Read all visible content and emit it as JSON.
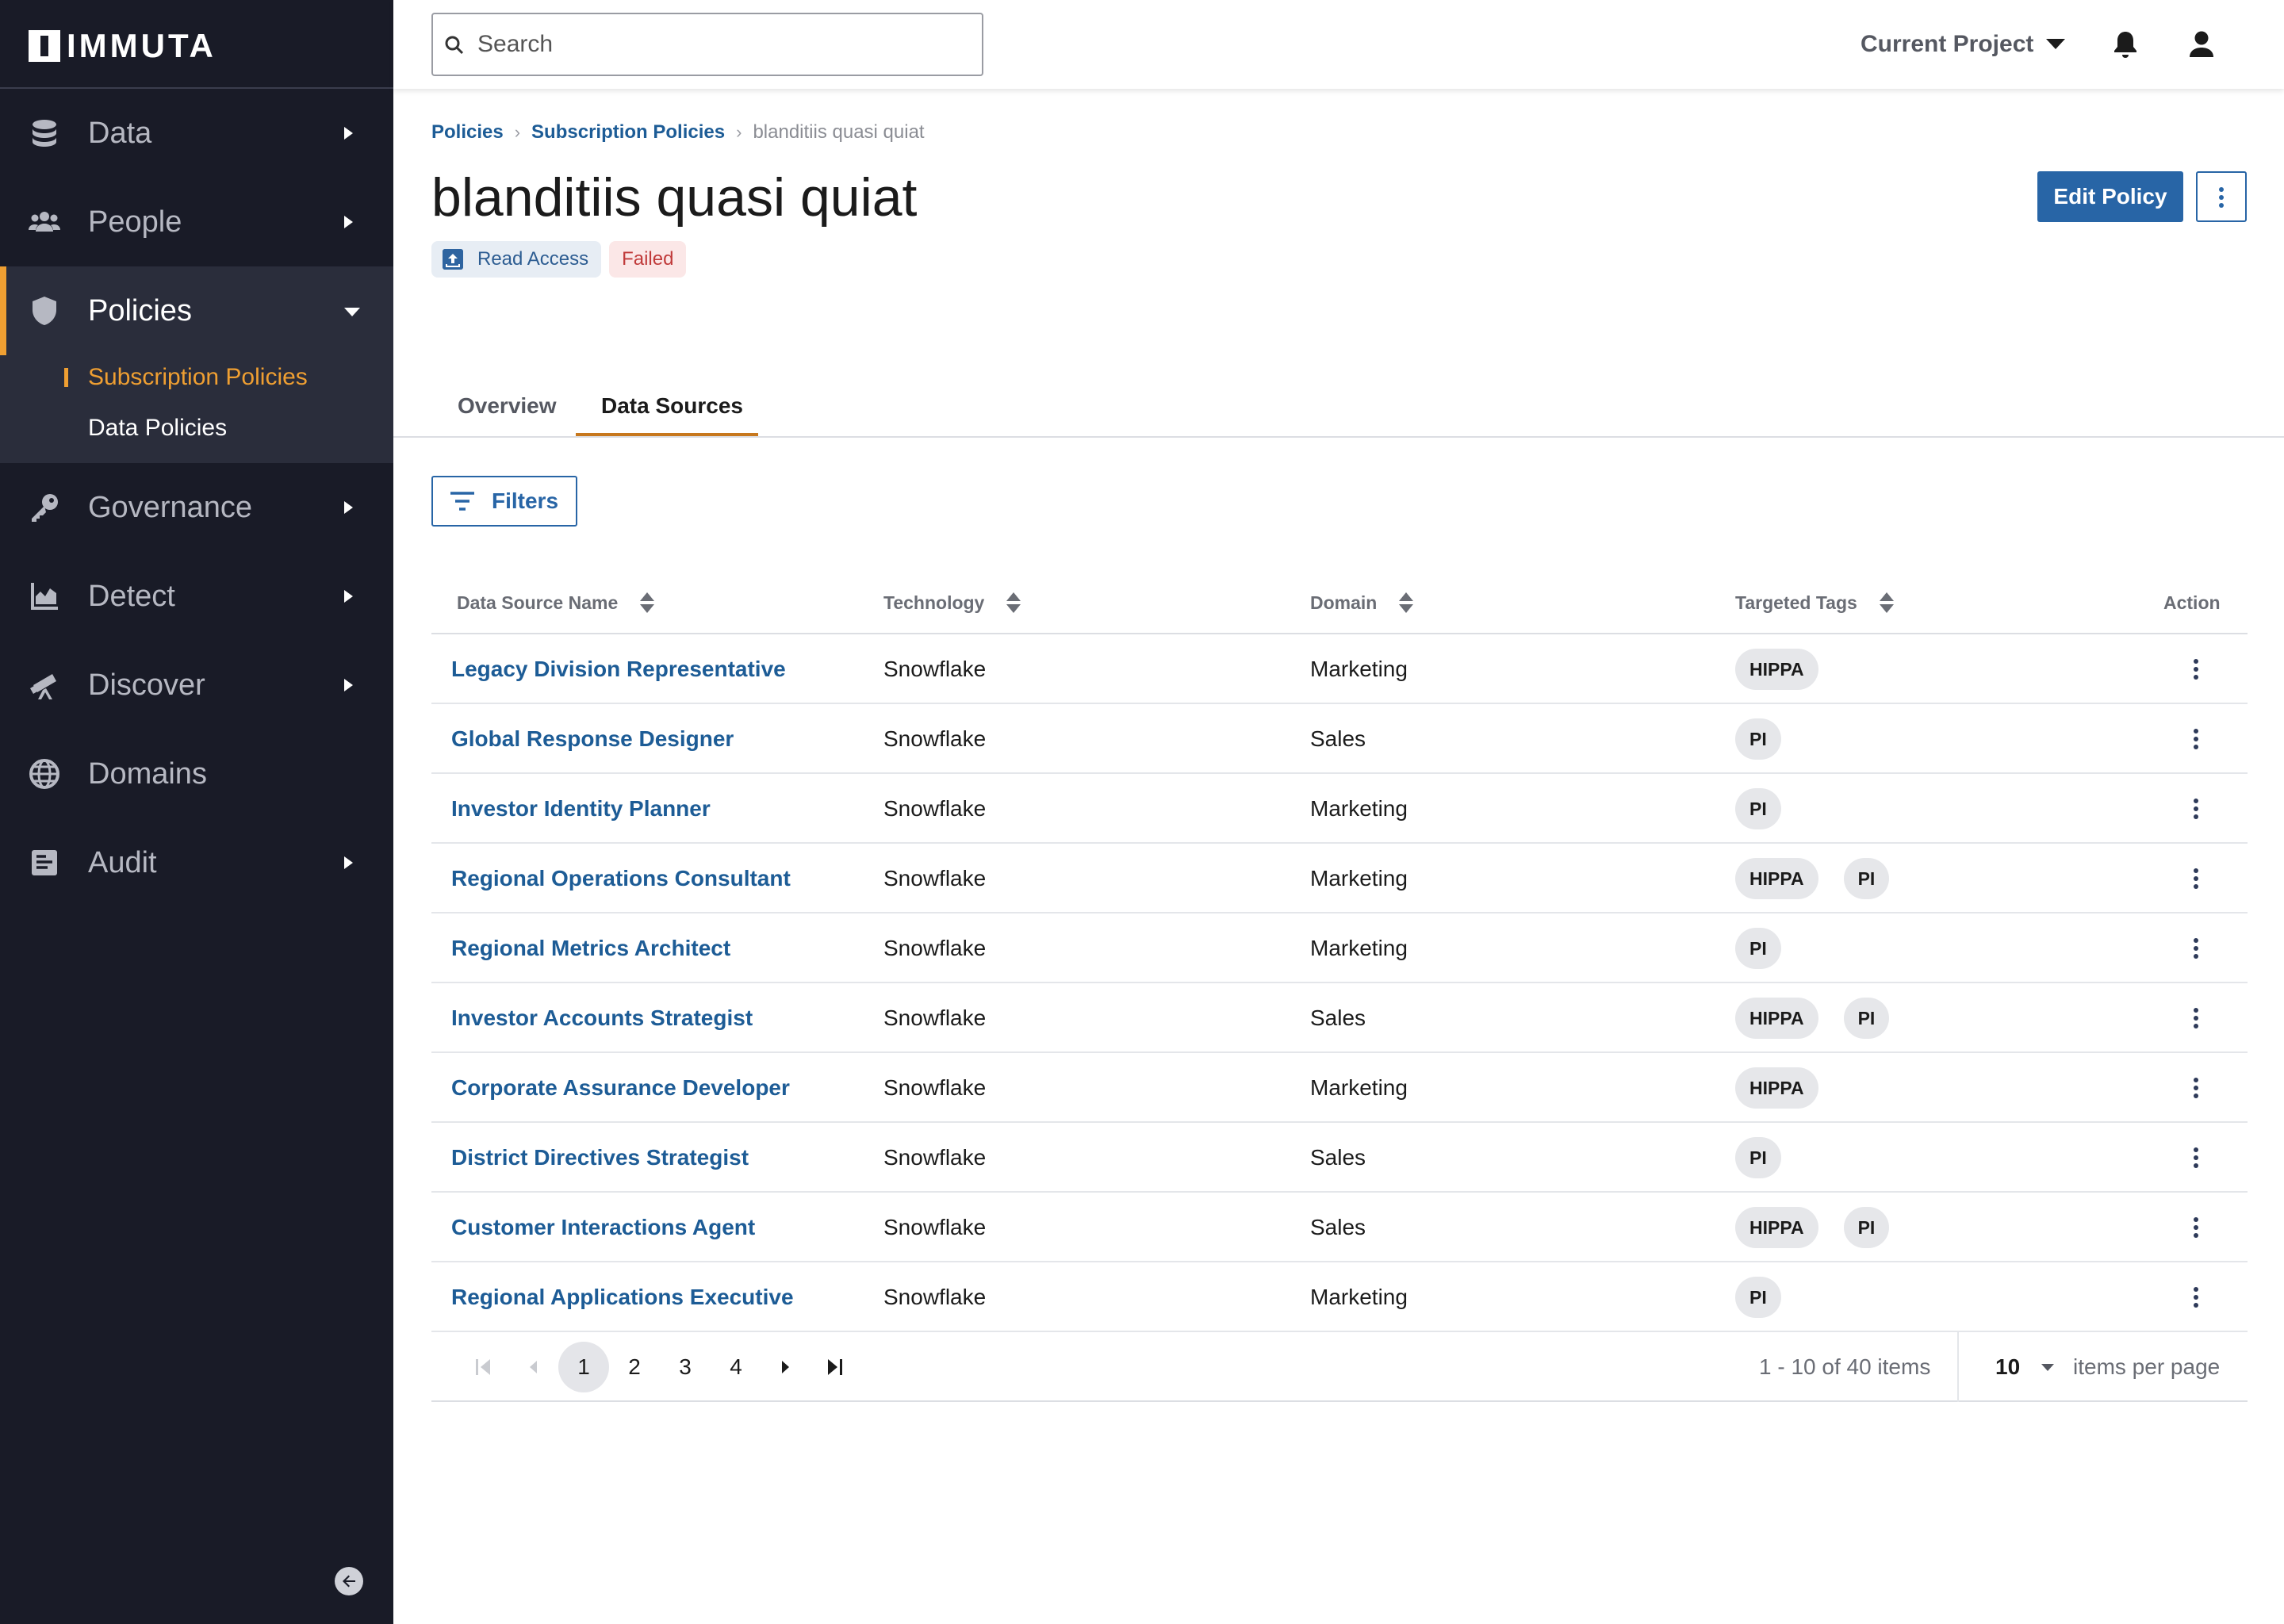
{
  "app": {
    "logo_text": "IMMUTA"
  },
  "sidebar": {
    "items": [
      {
        "label": "Data",
        "icon": "database-icon"
      },
      {
        "label": "People",
        "icon": "people-icon"
      },
      {
        "label": "Policies",
        "icon": "shield-icon"
      },
      {
        "label": "Governance",
        "icon": "key-icon"
      },
      {
        "label": "Detect",
        "icon": "chart-icon"
      },
      {
        "label": "Discover",
        "icon": "telescope-icon"
      },
      {
        "label": "Domains",
        "icon": "globe-icon"
      },
      {
        "label": "Audit",
        "icon": "audit-icon"
      }
    ],
    "policies_sub": {
      "current": "Subscription Policies",
      "other": "Data Policies"
    }
  },
  "topbar": {
    "search_placeholder": "Search",
    "project_label": "Current Project"
  },
  "breadcrumb": {
    "root": "Policies",
    "parent": "Subscription Policies",
    "current": "blanditiis quasi quiat"
  },
  "page": {
    "title": "blanditiis quasi quiat",
    "badge_access": "Read Access",
    "badge_status": "Failed",
    "edit_button": "Edit Policy"
  },
  "tabs": {
    "overview": "Overview",
    "data_sources": "Data Sources"
  },
  "filters_button": "Filters",
  "table": {
    "headers": {
      "name": "Data Source Name",
      "technology": "Technology",
      "domain": "Domain",
      "tags": "Targeted Tags",
      "action": "Action"
    },
    "rows": [
      {
        "name": "Legacy Division Representative",
        "technology": "Snowflake",
        "domain": "Marketing",
        "tags": [
          "HIPPA"
        ]
      },
      {
        "name": "Global Response Designer",
        "technology": "Snowflake",
        "domain": "Sales",
        "tags": [
          "PI"
        ]
      },
      {
        "name": "Investor Identity Planner",
        "technology": "Snowflake",
        "domain": "Marketing",
        "tags": [
          "PI"
        ]
      },
      {
        "name": "Regional Operations Consultant",
        "technology": "Snowflake",
        "domain": "Marketing",
        "tags": [
          "HIPPA",
          "PI"
        ]
      },
      {
        "name": "Regional Metrics Architect",
        "technology": "Snowflake",
        "domain": "Marketing",
        "tags": [
          "PI"
        ]
      },
      {
        "name": "Investor Accounts Strategist",
        "technology": "Snowflake",
        "domain": "Sales",
        "tags": [
          "HIPPA",
          "PI"
        ]
      },
      {
        "name": "Corporate Assurance Developer",
        "technology": "Snowflake",
        "domain": "Marketing",
        "tags": [
          "HIPPA"
        ]
      },
      {
        "name": "District Directives Strategist",
        "technology": "Snowflake",
        "domain": "Sales",
        "tags": [
          "PI"
        ]
      },
      {
        "name": "Customer Interactions Agent",
        "technology": "Snowflake",
        "domain": "Sales",
        "tags": [
          "HIPPA",
          "PI"
        ]
      },
      {
        "name": "Regional Applications Executive",
        "technology": "Snowflake",
        "domain": "Marketing",
        "tags": [
          "PI"
        ]
      }
    ]
  },
  "pager": {
    "pages": [
      "1",
      "2",
      "3",
      "4"
    ],
    "current_page": "1",
    "info": "1 - 10 of 40 items",
    "page_size": "10",
    "per_page_label": "items per page"
  }
}
